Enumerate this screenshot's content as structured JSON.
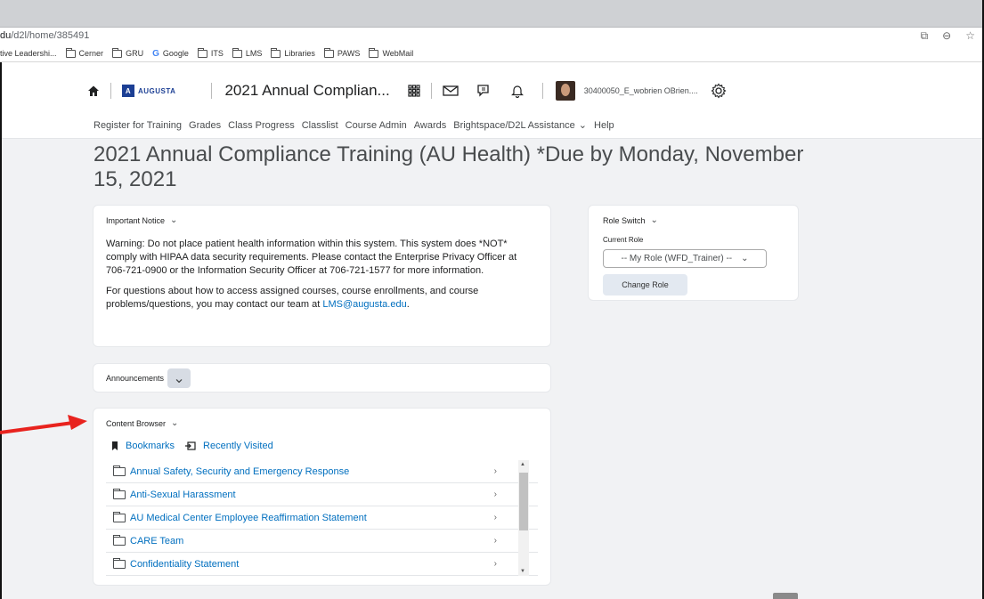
{
  "browser": {
    "url_host": "du",
    "url_path": "/d2l/home/385491",
    "bookmarks": [
      {
        "label": "tive Leadershi...",
        "icon": "none"
      },
      {
        "label": "Cerner",
        "icon": "folder-icon"
      },
      {
        "label": "GRU",
        "icon": "folder-icon"
      },
      {
        "label": "Google",
        "icon": "google-icon"
      },
      {
        "label": "ITS",
        "icon": "folder-icon"
      },
      {
        "label": "LMS",
        "icon": "folder-icon"
      },
      {
        "label": "Libraries",
        "icon": "folder-icon"
      },
      {
        "label": "PAWS",
        "icon": "folder-icon"
      },
      {
        "label": "WebMail",
        "icon": "folder-icon"
      }
    ]
  },
  "header": {
    "logo_text": "AUGUSTA",
    "course_title": "2021 Annual Complian...",
    "username": "30400050_E_wobrien OBrien...."
  },
  "nav": {
    "items": [
      "Register for Training",
      "Grades",
      "Class Progress",
      "Classlist",
      "Course Admin",
      "Awards",
      "Brightspace/D2L Assistance",
      "Help"
    ]
  },
  "page": {
    "title": "2021 Annual Compliance Training (AU Health) *Due by Monday, November 15, 2021"
  },
  "notice": {
    "heading": "Important Notice",
    "paragraph1": "Warning: Do not place patient health information within this system. This system does *NOT* comply with HIPAA data security requirements. Please contact the Enterprise Privacy Officer at 706-721-0900 or the Information Security Officer at 706-721-1577 for more information.",
    "paragraph2_prefix": "For questions about how to access assigned courses, course enrollments, and course problems/questions, you may contact our team at ",
    "email": "LMS@augusta.edu",
    "paragraph2_suffix": "."
  },
  "role_switch": {
    "heading": "Role Switch",
    "current_role_label": "Current Role",
    "selected_role": "-- My Role (WFD_Trainer) --",
    "button_label": "Change Role"
  },
  "announcements": {
    "heading": "Announcements"
  },
  "content_browser": {
    "heading": "Content Browser",
    "bookmarks_label": "Bookmarks",
    "recent_label": "Recently Visited",
    "items": [
      "Annual Safety, Security and Emergency Response",
      "Anti-Sexual Harassment",
      "AU Medical Center Employee Reaffirmation Statement",
      "CARE Team",
      "Confidentiality Statement"
    ]
  },
  "colors": {
    "link": "#006fbf",
    "annotation_arrow": "#e8231e",
    "page_bg": "#f1f2f4"
  }
}
